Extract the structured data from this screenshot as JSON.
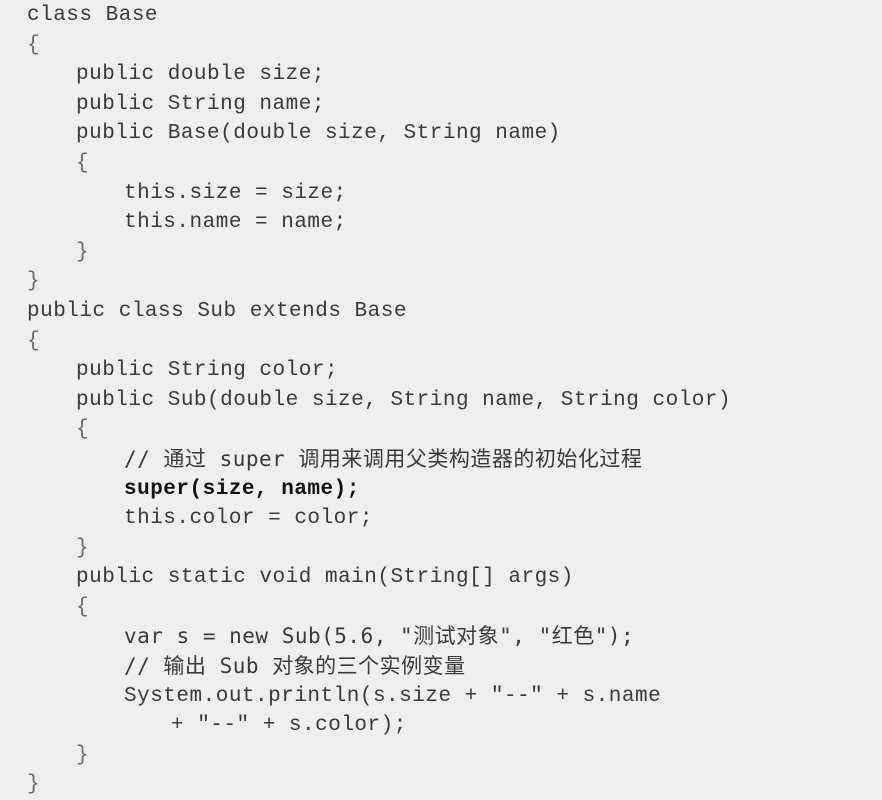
{
  "code": {
    "lines": [
      "class Base",
      "{",
      "public double size;",
      "public String name;",
      "public Base(double size, String name)",
      "{",
      "this.size = size;",
      "this.name = name;",
      "}",
      "}",
      "public class Sub extends Base",
      "{",
      "public String color;",
      "public Sub(double size, String name, String color)",
      "{",
      "// 通过 super 调用来调用父类构造器的初始化过程",
      "super(size, name);",
      "this.color = color;",
      "}",
      "public static void main(String[] args)",
      "{",
      "var s = new Sub(5.6, \"测试对象\", \"红色\");",
      "// 输出 Sub 对象的三个实例变量",
      "System.out.println(s.size + \"--\" + s.name",
      "+ \"--\" + s.color);",
      "}",
      "}"
    ]
  }
}
